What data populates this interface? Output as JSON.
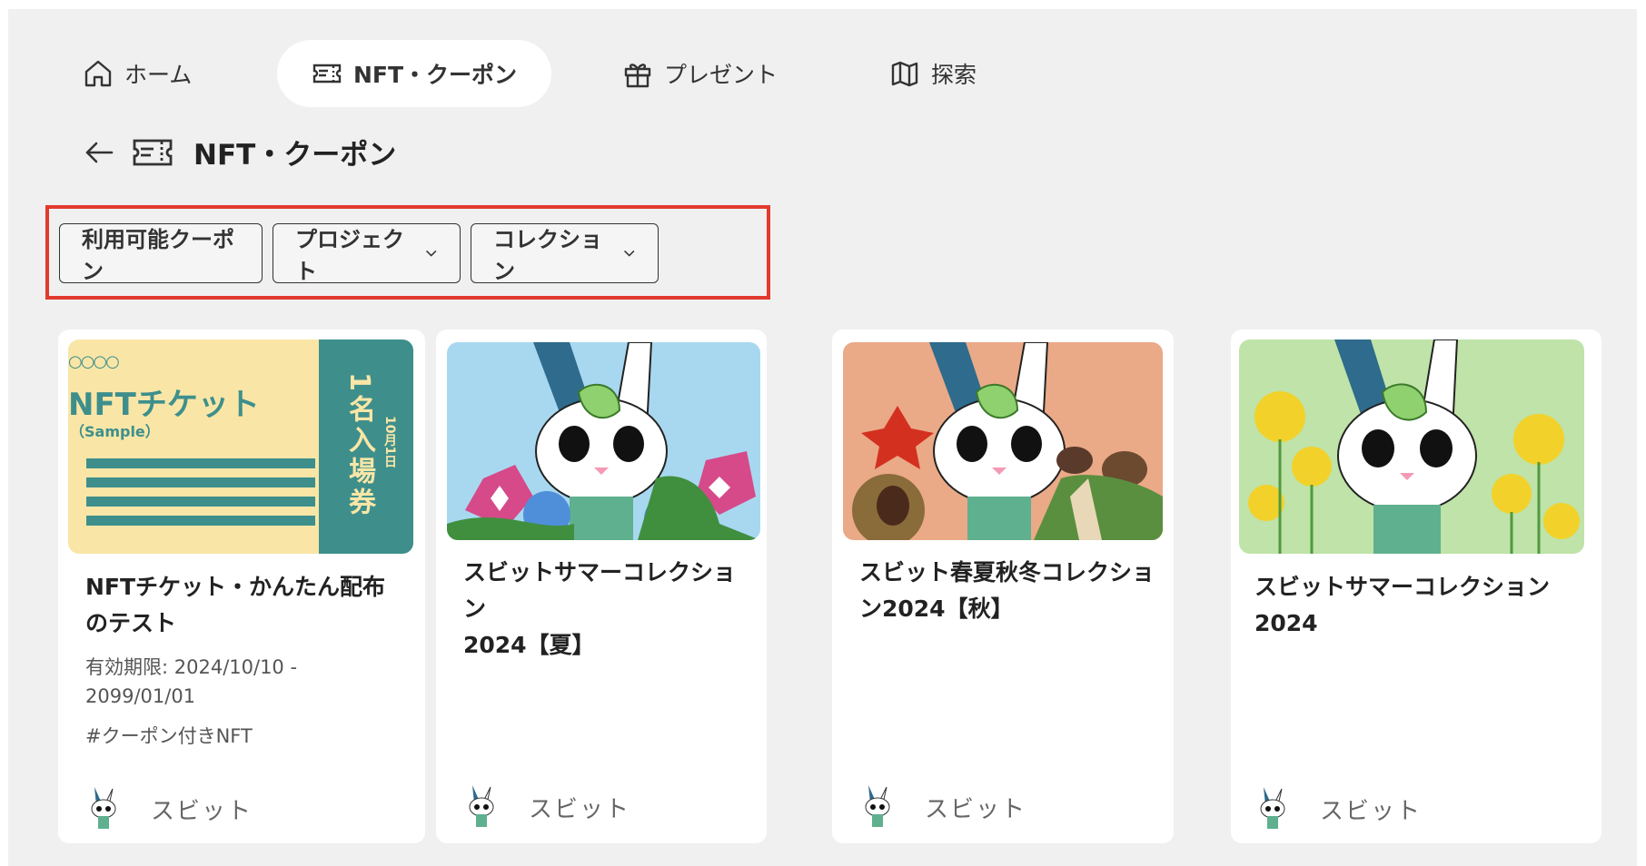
{
  "nav": {
    "items": [
      {
        "label": "ホーム",
        "icon": "home-icon"
      },
      {
        "label": "NFT・クーポン",
        "icon": "ticket-icon",
        "active": true
      },
      {
        "label": "プレゼント",
        "icon": "gift-icon"
      },
      {
        "label": "探索",
        "icon": "map-icon"
      }
    ]
  },
  "header": {
    "title": "NFT・クーポン"
  },
  "filters": {
    "available": "利用可能クーポン",
    "project": "プロジェクト",
    "collection": "コレクション"
  },
  "cards": [
    {
      "title_line1": "NFTチケット・かんたん配布",
      "title_line2": "のテスト",
      "validity_line1": "有効期限: 2024/10/10 -",
      "validity_line2": "2099/01/01",
      "tag": "#クーポン付きNFT",
      "creator": "スビット",
      "thumb": {
        "heading": "NFTチケット",
        "sub": "（Sample）",
        "dots": "○○○○",
        "stub_main": "1名入場券",
        "stub_date": "10月1日"
      }
    },
    {
      "title_line1": "スビットサマーコレクション",
      "title_line2": "2024【夏】",
      "creator": "スビット",
      "bg": "#a8d8f0"
    },
    {
      "title_line1": "スビット春夏秋冬コレクショ",
      "title_line2": "ン2024【秋】",
      "creator": "スビット",
      "bg": "#eaa987"
    },
    {
      "title_line1": "スビットサマーコレクション",
      "title_line2": "2024",
      "creator": "スビット",
      "bg": "#bfe3a8"
    }
  ],
  "colors": {
    "highlight": "#e23a2e",
    "panel": "#f0f0f0",
    "ticket_yellow": "#f9e6a6",
    "ticket_teal": "#3e8f8c"
  }
}
